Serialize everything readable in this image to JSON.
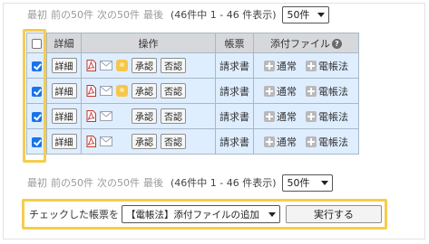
{
  "pager_top": {
    "first": "最初",
    "prev": "前の50件",
    "next": "次の50件",
    "last": "最後",
    "count": "(46件中 1 - 46 件表示)",
    "per_page": "50件"
  },
  "pager_bottom": {
    "first": "最初",
    "prev": "前の50件",
    "next": "次の50件",
    "last": "最後",
    "count": "(46件中 1 - 46 件表示)",
    "per_page": "50件"
  },
  "table": {
    "headers": {
      "detail": "詳細",
      "operation": "操作",
      "doc_type": "帳票",
      "attachments": "添付ファイル",
      "help_icon": "?"
    },
    "rows": [
      {
        "checked": true,
        "detail": "詳細",
        "has_stamp": true,
        "approve": "承認",
        "reject": "否認",
        "doc_type": "請求書",
        "att_normal": "通常",
        "att_ebook": "電帳法"
      },
      {
        "checked": true,
        "detail": "詳細",
        "has_stamp": true,
        "approve": "承認",
        "reject": "否認",
        "doc_type": "請求書",
        "att_normal": "通常",
        "att_ebook": "電帳法"
      },
      {
        "checked": true,
        "detail": "詳細",
        "has_stamp": false,
        "approve": "承認",
        "reject": "否認",
        "doc_type": "請求書",
        "att_normal": "通常",
        "att_ebook": "電帳法"
      },
      {
        "checked": true,
        "detail": "詳細",
        "has_stamp": false,
        "approve": "承認",
        "reject": "否認",
        "doc_type": "請求書",
        "att_normal": "通常",
        "att_ebook": "電帳法"
      }
    ]
  },
  "bulk_action": {
    "label": "チェックした帳票を",
    "selected_action": "【電帳法】添付ファイルの追加",
    "execute": "実行する"
  },
  "colors": {
    "highlight": "#f5cd4d",
    "row_background": "#dfeeff",
    "header_background": "#d6d8db",
    "checkbox_checked": "#1a73e8"
  }
}
